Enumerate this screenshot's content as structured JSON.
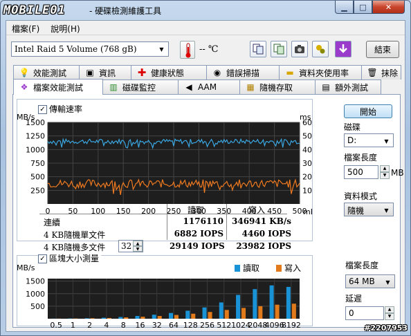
{
  "window": {
    "logo": "MOBILE01",
    "title": "- 硬碟檢測維護工具"
  },
  "menu": [
    "檔案(F)",
    "說明(H)"
  ],
  "toolbar": {
    "drive": "Intel Raid 5 Volume (768 gB)",
    "temperature": "-- ℃",
    "exit_label": "結束"
  },
  "tabs_row1": [
    {
      "label": "效能測試",
      "icon": "lightbulb-icon"
    },
    {
      "label": "資訊",
      "icon": "info-icon"
    },
    {
      "label": "健康狀態",
      "icon": "health-cross-icon"
    },
    {
      "label": "錯誤掃描",
      "icon": "error-scan-icon"
    },
    {
      "label": "資料夾使用率",
      "icon": "folder-icon"
    },
    {
      "label": "抹除",
      "icon": "trash-icon"
    }
  ],
  "tabs_row2": [
    {
      "label": "檔案效能測試",
      "icon": "file-benchmark-icon"
    },
    {
      "label": "磁碟監控",
      "icon": "disk-monitor-icon"
    },
    {
      "label": "AAM",
      "icon": "speaker-icon"
    },
    {
      "label": "隨機存取",
      "icon": "random-access-icon"
    },
    {
      "label": "額外測試",
      "icon": "extra-test-icon"
    }
  ],
  "transfer": {
    "checkbox_label": "傳輸速率",
    "y_unit_left": "MB/s",
    "y_unit_right": "ms",
    "x_unit": "mB",
    "y_ticks_left": [
      "1500",
      "1250",
      "1000",
      "750",
      "500",
      "250"
    ],
    "y_ticks_right": [
      "60",
      "50",
      "40",
      "30",
      "20",
      "10"
    ],
    "x_ticks": [
      "0",
      "50",
      "100",
      "150",
      "200",
      "250",
      "300",
      "350",
      "400",
      "450",
      "500"
    ]
  },
  "results": {
    "col_read": "讀取",
    "col_write": "寫入",
    "rows": [
      {
        "label": "連續",
        "read": "1176110",
        "write": "346941 KB/s",
        "spin": ""
      },
      {
        "label": "4 KB隨機單文件",
        "read": "6882 IOPS",
        "write": "4460 IOPS",
        "spin": ""
      },
      {
        "label": "4 KB隨機多文件",
        "read": "29149 IOPS",
        "write": "23982 IOPS",
        "spin": "32"
      }
    ]
  },
  "right_top": {
    "start_label": "開始",
    "disk_label": "磁碟",
    "disk_value": "D:",
    "filelen_label": "檔案長度",
    "filelen_value": "500",
    "filelen_unit": "MB",
    "datamode_label": "資料模式",
    "datamode_value": "隨機"
  },
  "block": {
    "checkbox_label": "區塊大小測量",
    "y_unit": "MB/s",
    "legend_read": "讀取",
    "legend_write": "寫入",
    "y_ticks": [
      "1500",
      "1000",
      "500"
    ]
  },
  "right_bottom": {
    "filelen_label": "檔案長度",
    "filelen_value": "64 MB",
    "delay_label": "延遲",
    "delay_value": "0"
  },
  "watermark": "#2207953",
  "colors": {
    "read": "#1a93d6",
    "write": "#e07a1a",
    "chart_bg": "#1e1e1e",
    "read_line": "#3aa6e0",
    "write_line": "#f07a20"
  },
  "chart_data": [
    {
      "type": "line",
      "title": "傳輸速率",
      "xlabel": "mB",
      "ylabel": "MB/s",
      "y2label": "ms",
      "xlim": [
        0,
        500
      ],
      "ylim": [
        0,
        1500
      ],
      "y2lim": [
        0,
        60
      ],
      "series": [
        {
          "name": "讀取",
          "axis": "left",
          "values_approx": 1150
        },
        {
          "name": "寫入",
          "axis": "right",
          "values_approx": 15
        }
      ]
    },
    {
      "type": "bar",
      "title": "區塊大小測量",
      "ylabel": "MB/s",
      "ylim": [
        0,
        1600
      ],
      "categories": [
        "0.5",
        "1",
        "2",
        "4",
        "8",
        "16",
        "32",
        "64",
        "128",
        "256",
        "512",
        "1024",
        "2048",
        "4096",
        "8192"
      ],
      "series": [
        {
          "name": "讀取",
          "values": [
            5,
            10,
            20,
            40,
            70,
            110,
            160,
            230,
            320,
            450,
            650,
            950,
            1180,
            1330,
            1270
          ]
        },
        {
          "name": "寫入",
          "values": [
            5,
            10,
            20,
            30,
            55,
            80,
            110,
            150,
            200,
            270,
            350,
            430,
            500,
            560,
            600
          ]
        }
      ]
    }
  ]
}
